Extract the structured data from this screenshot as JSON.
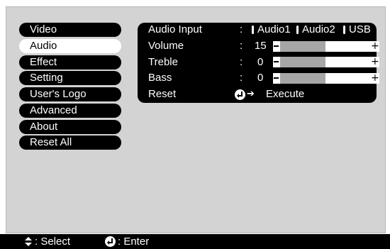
{
  "sidebar": {
    "items": [
      {
        "label": "Video",
        "selected": false
      },
      {
        "label": "Audio",
        "selected": true
      },
      {
        "label": "Effect",
        "selected": false
      },
      {
        "label": "Setting",
        "selected": false
      },
      {
        "label": "User's Logo",
        "selected": false
      },
      {
        "label": "Advanced",
        "selected": false
      },
      {
        "label": "About",
        "selected": false
      },
      {
        "label": "Reset All",
        "selected": false
      }
    ]
  },
  "audio": {
    "colon": ":",
    "audio_input": {
      "label": "Audio Input",
      "options": [
        "Audio1",
        "Audio2",
        "USB"
      ]
    },
    "volume": {
      "label": "Volume",
      "value": "15",
      "level": 0.5
    },
    "treble": {
      "label": "Treble",
      "value": "0",
      "level": 0.5
    },
    "bass": {
      "label": "Bass",
      "value": "0",
      "level": 0.5
    },
    "reset": {
      "label": "Reset",
      "action": "Execute"
    }
  },
  "footer": {
    "select_label": ": Select",
    "enter_label": ": Enter"
  },
  "icons": {
    "select": "up-down-arrows-icon",
    "enter": "enter-icon",
    "arrow": "right-arrow-icon"
  },
  "colors": {
    "background": "#d3d3d3",
    "menu_item": "#000000",
    "selected_item": "#ffffff",
    "slider_fill": "#a6a6a6"
  }
}
